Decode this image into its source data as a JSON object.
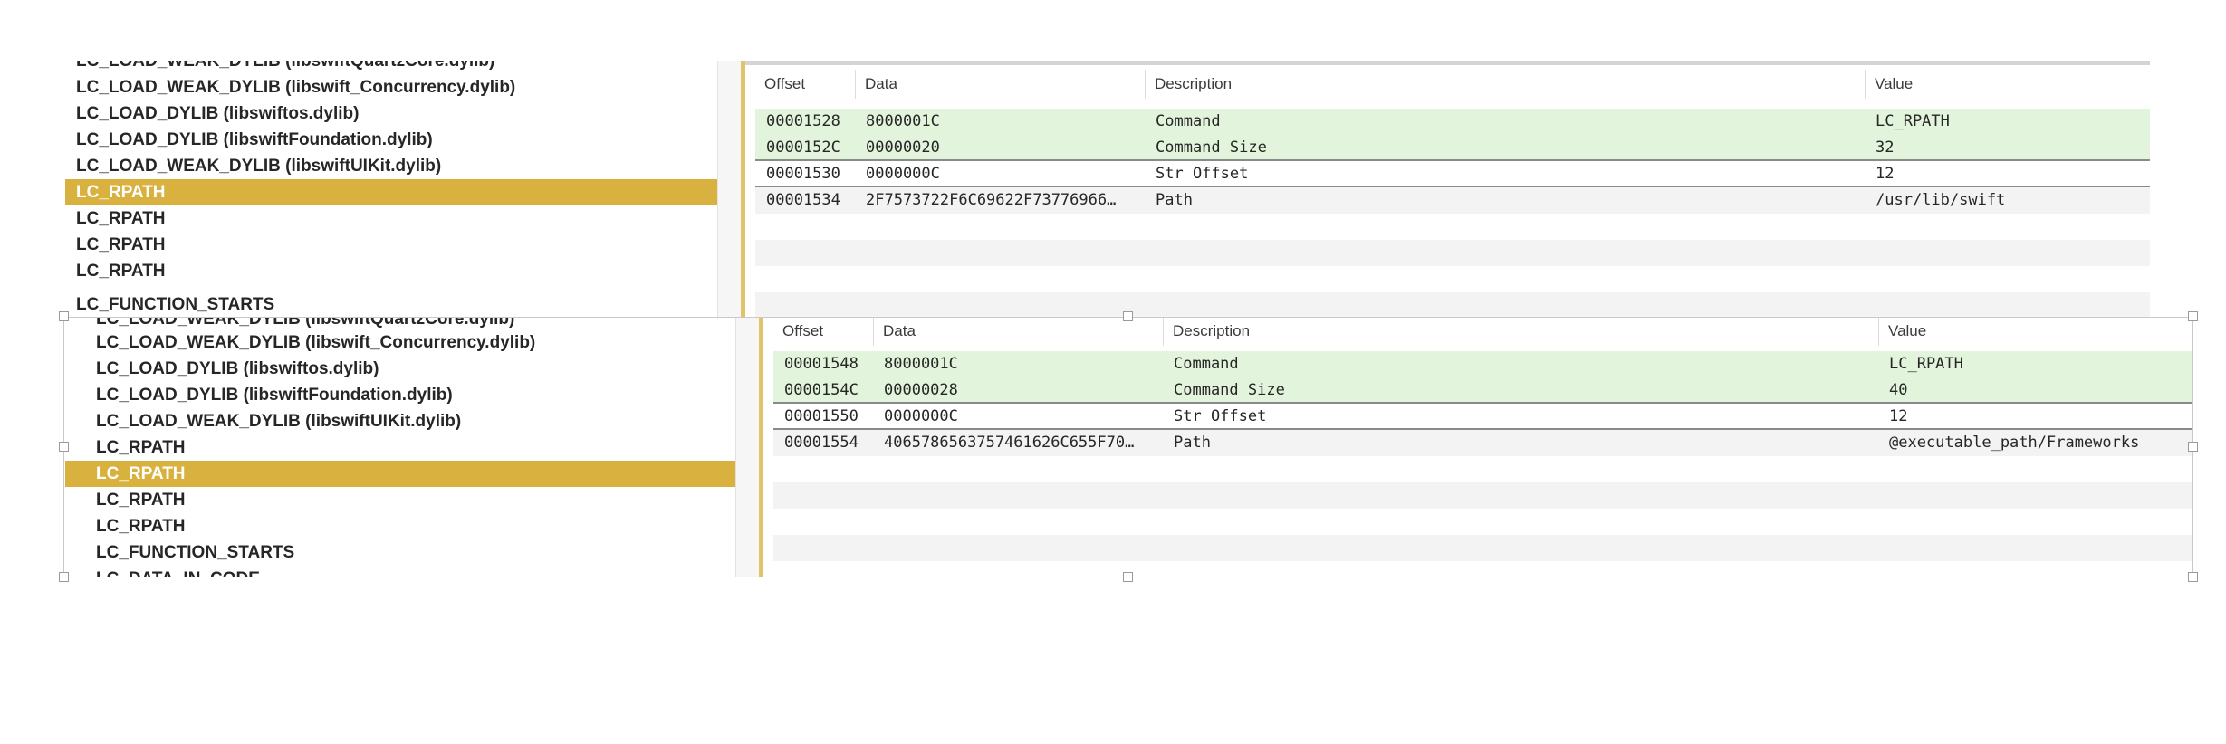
{
  "top_panel": {
    "list_items": [
      {
        "label": "LC_LOAD_WEAK_DYLIB (libswiftQuartzCore.dylib)",
        "selected": false
      },
      {
        "label": "LC_LOAD_WEAK_DYLIB (libswift_Concurrency.dylib)",
        "selected": false
      },
      {
        "label": "LC_LOAD_DYLIB (libswiftos.dylib)",
        "selected": false
      },
      {
        "label": "LC_LOAD_DYLIB (libswiftFoundation.dylib)",
        "selected": false
      },
      {
        "label": "LC_LOAD_WEAK_DYLIB (libswiftUIKit.dylib)",
        "selected": false
      },
      {
        "label": "LC_RPATH",
        "selected": true
      },
      {
        "label": "LC_RPATH",
        "selected": false
      },
      {
        "label": "LC_RPATH",
        "selected": false
      },
      {
        "label": "LC_RPATH",
        "selected": false
      },
      {
        "label": "LC_FUNCTION_STARTS",
        "selected": false
      }
    ],
    "columns": [
      "Offset",
      "Data",
      "Description",
      "Value"
    ],
    "rows": [
      {
        "offset": "00001528",
        "data": "8000001C",
        "description": "Command",
        "value": "LC_RPATH"
      },
      {
        "offset": "0000152C",
        "data": "00000020",
        "description": "Command Size",
        "value": "32"
      },
      {
        "offset": "00001530",
        "data": "0000000C",
        "description": "Str Offset",
        "value": "12"
      },
      {
        "offset": "00001534",
        "data": "2F7573722F6C69622F73776966…",
        "description": "Path",
        "value": "/usr/lib/swift"
      }
    ]
  },
  "bottom_panel": {
    "list_items": [
      {
        "label": "LC_LOAD_WEAK_DYLIB (libswiftQuartzCore.dylib)",
        "selected": false
      },
      {
        "label": "LC_LOAD_WEAK_DYLIB (libswift_Concurrency.dylib)",
        "selected": false
      },
      {
        "label": "LC_LOAD_DYLIB (libswiftos.dylib)",
        "selected": false
      },
      {
        "label": "LC_LOAD_DYLIB (libswiftFoundation.dylib)",
        "selected": false
      },
      {
        "label": "LC_LOAD_WEAK_DYLIB (libswiftUIKit.dylib)",
        "selected": false
      },
      {
        "label": "LC_RPATH",
        "selected": false
      },
      {
        "label": "LC_RPATH",
        "selected": true
      },
      {
        "label": "LC_RPATH",
        "selected": false
      },
      {
        "label": "LC_RPATH",
        "selected": false
      },
      {
        "label": "LC_FUNCTION_STARTS",
        "selected": false
      },
      {
        "label": "LC_DATA_IN_CODE",
        "selected": false
      }
    ],
    "columns": [
      "Offset",
      "Data",
      "Description",
      "Value"
    ],
    "rows": [
      {
        "offset": "00001548",
        "data": "8000001C",
        "description": "Command",
        "value": "LC_RPATH"
      },
      {
        "offset": "0000154C",
        "data": "00000028",
        "description": "Command Size",
        "value": "40"
      },
      {
        "offset": "00001550",
        "data": "0000000C",
        "description": "Str Offset",
        "value": "12"
      },
      {
        "offset": "00001554",
        "data": "4065786563757461626C655F70…",
        "description": "Path",
        "value": "@executable_path/Frameworks"
      }
    ]
  },
  "colors": {
    "selection": "#d9b13f",
    "splitter": "#e3c36a",
    "row_highlight": "#e3f4dc",
    "row_alternate": "#f3f3f3"
  }
}
